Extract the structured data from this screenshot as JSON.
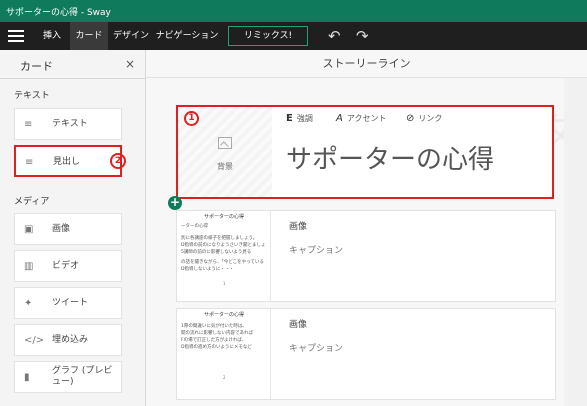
{
  "window": {
    "title": "サポーターの心得 - Sway"
  },
  "ribbon": {
    "tabs": [
      {
        "label": "挿入"
      },
      {
        "label": "カード"
      },
      {
        "label": "デザイン"
      },
      {
        "label": "ナビゲーション"
      }
    ],
    "remix_label": "リミックス!",
    "undo": "↶",
    "redo": "↷"
  },
  "panel": {
    "title": "カード",
    "close": "×",
    "sections": [
      {
        "label": "テキスト"
      },
      {
        "label": "メディア"
      }
    ],
    "items": [
      {
        "label": "テキスト",
        "icon": "≡"
      },
      {
        "label": "見出し",
        "icon": "≡",
        "badge": "2"
      },
      {
        "label": "画像",
        "icon": "▣"
      },
      {
        "label": "ビデオ",
        "icon": "▥"
      },
      {
        "label": "ツイート",
        "icon": "✦"
      },
      {
        "label": "埋め込み",
        "icon": "</>"
      },
      {
        "label": "グラフ (プレビュー)",
        "icon": "▮"
      }
    ]
  },
  "storyline": {
    "header": "ストーリーライン",
    "title_card": {
      "badge": "1",
      "background_label": "背景",
      "format": [
        {
          "icon": "E",
          "label": "強調"
        },
        {
          "icon": "A",
          "label": "アクセント"
        },
        {
          "icon": "⊘",
          "label": "リンク"
        }
      ],
      "heading": "サポーターの心得"
    },
    "add_button": "+",
    "cards": [
      {
        "label": "画像",
        "caption": "キャプション",
        "thumb": {
          "title": "サポーターの心得",
          "lines": [
            "ーターの心得",
            "別に各講座の様子を把握しましょう。",
            "D指導の前のになりようさいき聞とましょ",
            "5講師の前のに影響しないよう見る",
            "の話を聞きながら、「今どこをやっている",
            "D指導しないように・・・"
          ],
          "page": "1"
        }
      },
      {
        "label": "画像",
        "caption": "キャプション",
        "thumb": {
          "title": "サポーターの心得",
          "lines": [
            "1際の間違いに気が付いた時は、",
            "開の流れに影響しない内容であれば",
            "Fの場で訂正した方がよければ、",
            "D指導の進め方のいようにメモなど"
          ],
          "page": "2"
        }
      }
    ]
  }
}
